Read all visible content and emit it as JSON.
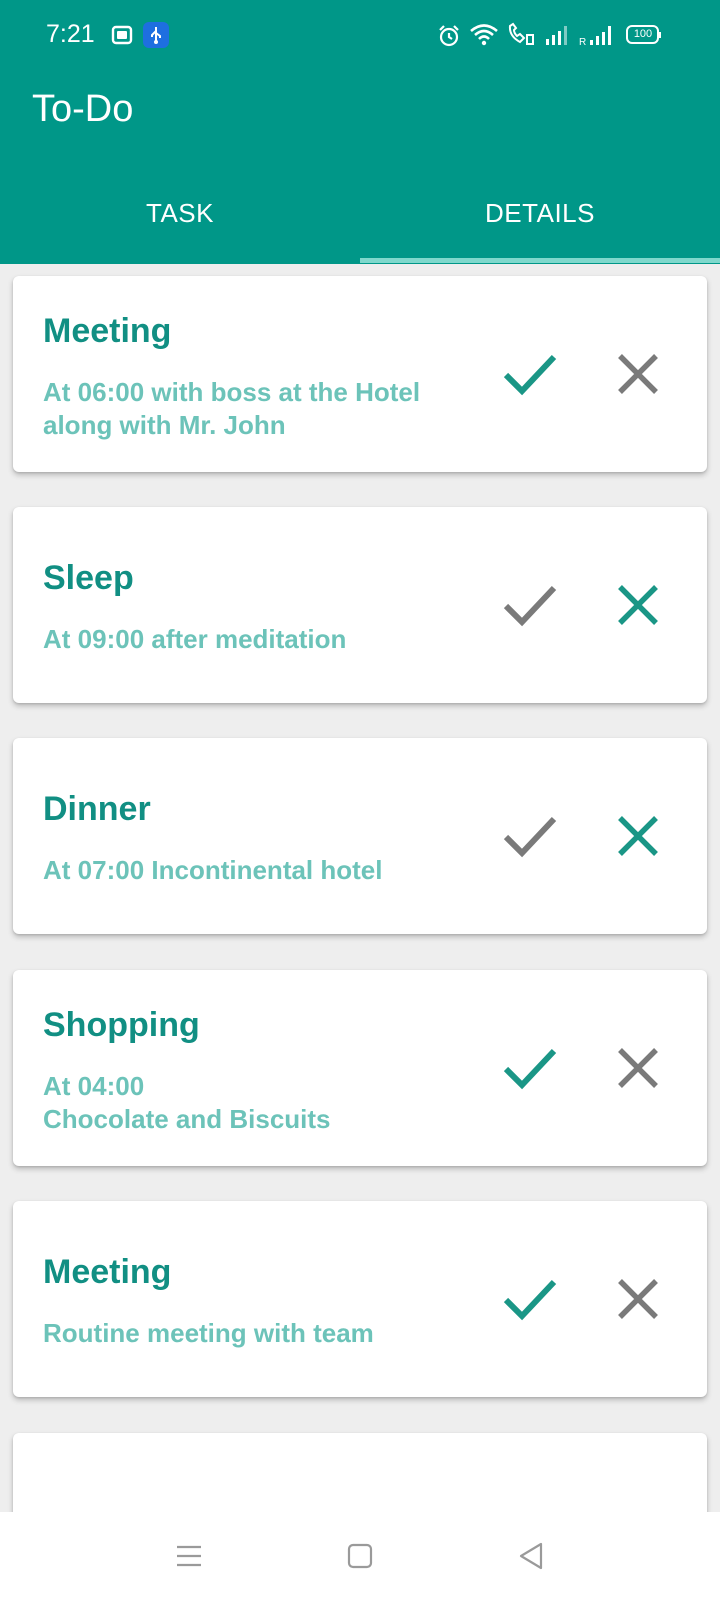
{
  "status_bar": {
    "time": "7:21",
    "battery": "100"
  },
  "app": {
    "title": "To-Do"
  },
  "tabs": [
    {
      "label": "TASK",
      "selected": false
    },
    {
      "label": "DETAILS",
      "selected": true
    }
  ],
  "colors": {
    "primary": "#009788",
    "title_text": "#118f83",
    "desc_text": "#6cc3b9",
    "active_icon": "#1a9686",
    "inactive_icon": "#7a7a7a"
  },
  "tasks": [
    {
      "title": "Meeting",
      "description": "At 06:00 with boss at the Hotel\nalong with Mr. John",
      "check_state": "active",
      "cross_state": "inactive"
    },
    {
      "title": "Sleep",
      "description": "At 09:00 after meditation",
      "check_state": "inactive",
      "cross_state": "active"
    },
    {
      "title": "Dinner",
      "description": "At 07:00 Incontinental hotel",
      "check_state": "inactive",
      "cross_state": "active"
    },
    {
      "title": "Shopping",
      "description": "At 04:00\nChocolate and Biscuits",
      "check_state": "active",
      "cross_state": "inactive"
    },
    {
      "title": "Meeting",
      "description": "Routine meeting with team",
      "check_state": "active",
      "cross_state": "inactive"
    }
  ],
  "nav_bar": {
    "items": [
      "menu-icon",
      "home-square-icon",
      "back-triangle-icon"
    ]
  }
}
